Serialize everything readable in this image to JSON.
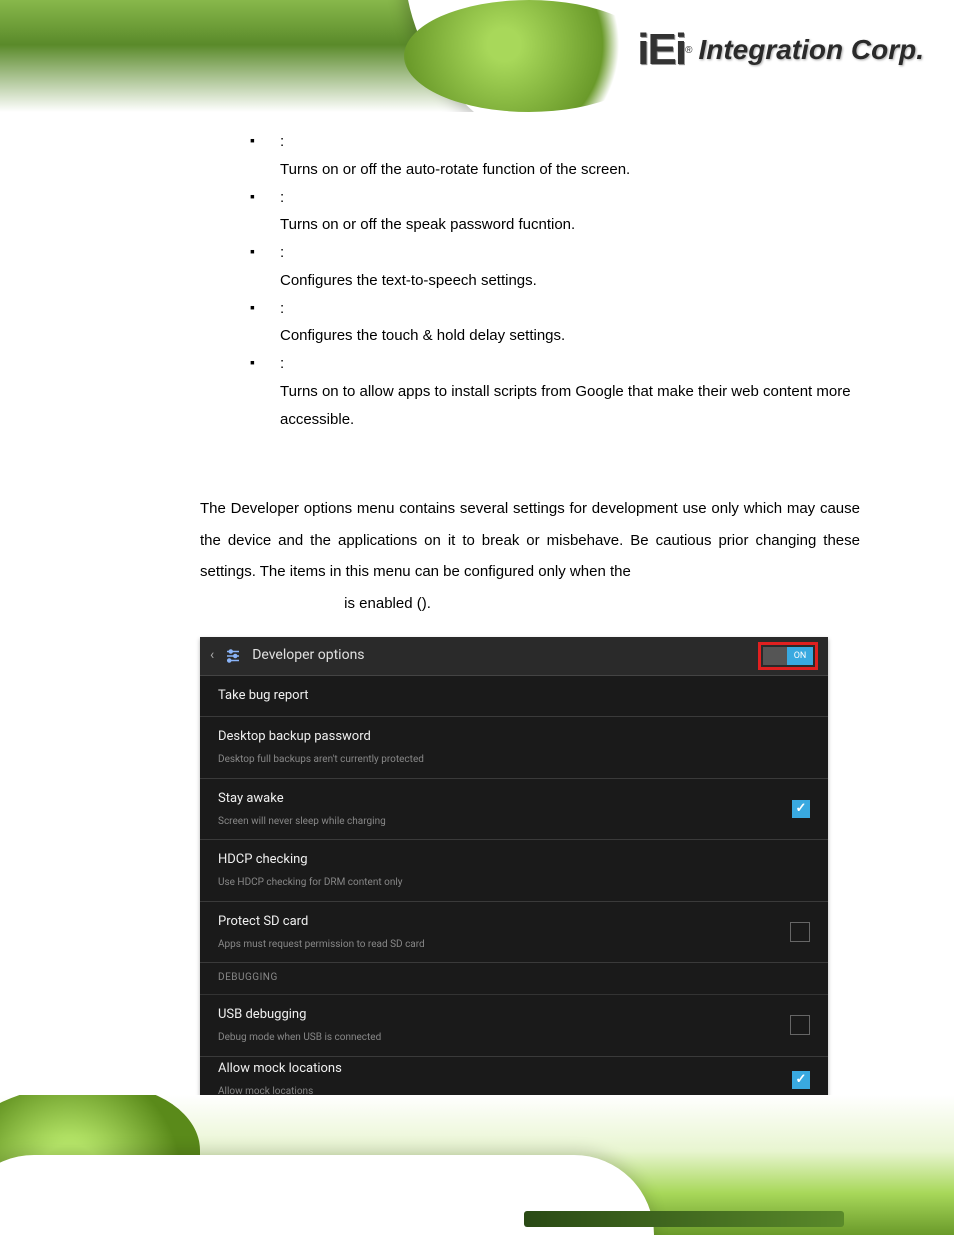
{
  "header": {
    "logo_main": "iEi",
    "logo_tm": "®",
    "logo_sub": "Integration Corp."
  },
  "bullets": [
    {
      "title": "",
      "desc": "Turns on or off the auto-rotate function of the screen."
    },
    {
      "title": "",
      "desc": "Turns on or off the speak password fucntion."
    },
    {
      "title": "",
      "desc": "Configures the text-to-speech settings."
    },
    {
      "title": "",
      "desc": "Configures the touch & hold delay settings."
    },
    {
      "title": "",
      "desc": "Turns on to allow apps to install scripts from Google that make their web content more accessible."
    }
  ],
  "intro": {
    "p1a": "The Developer options menu contains several settings for development use only which may cause the device and the applications on it to break or misbehave. Be cautious prior changing these settings. The items in this menu can be configured only when the ",
    "enabled_prefix": "",
    "p1b": " is enabled (",
    "p1c": ")."
  },
  "screenshot": {
    "title": "Developer options",
    "toggle": "ON",
    "rows": [
      {
        "t": "Take bug report",
        "s": "",
        "control": "none"
      },
      {
        "t": "Desktop backup password",
        "s": "Desktop full backups aren't currently protected",
        "control": "none"
      },
      {
        "t": "Stay awake",
        "s": "Screen will never sleep while charging",
        "control": "checked"
      },
      {
        "t": "HDCP checking",
        "s": "Use HDCP checking for DRM content only",
        "control": "none"
      },
      {
        "t": "Protect SD card",
        "s": "Apps must request permission to read SD card",
        "control": "unchecked"
      }
    ],
    "section_label": "DEBUGGING",
    "rows2": [
      {
        "t": "USB debugging",
        "s": "Debug mode when USB is connected",
        "control": "unchecked"
      },
      {
        "t": "Allow mock locations",
        "s": "Allow mock locations",
        "control": "checked"
      }
    ]
  }
}
